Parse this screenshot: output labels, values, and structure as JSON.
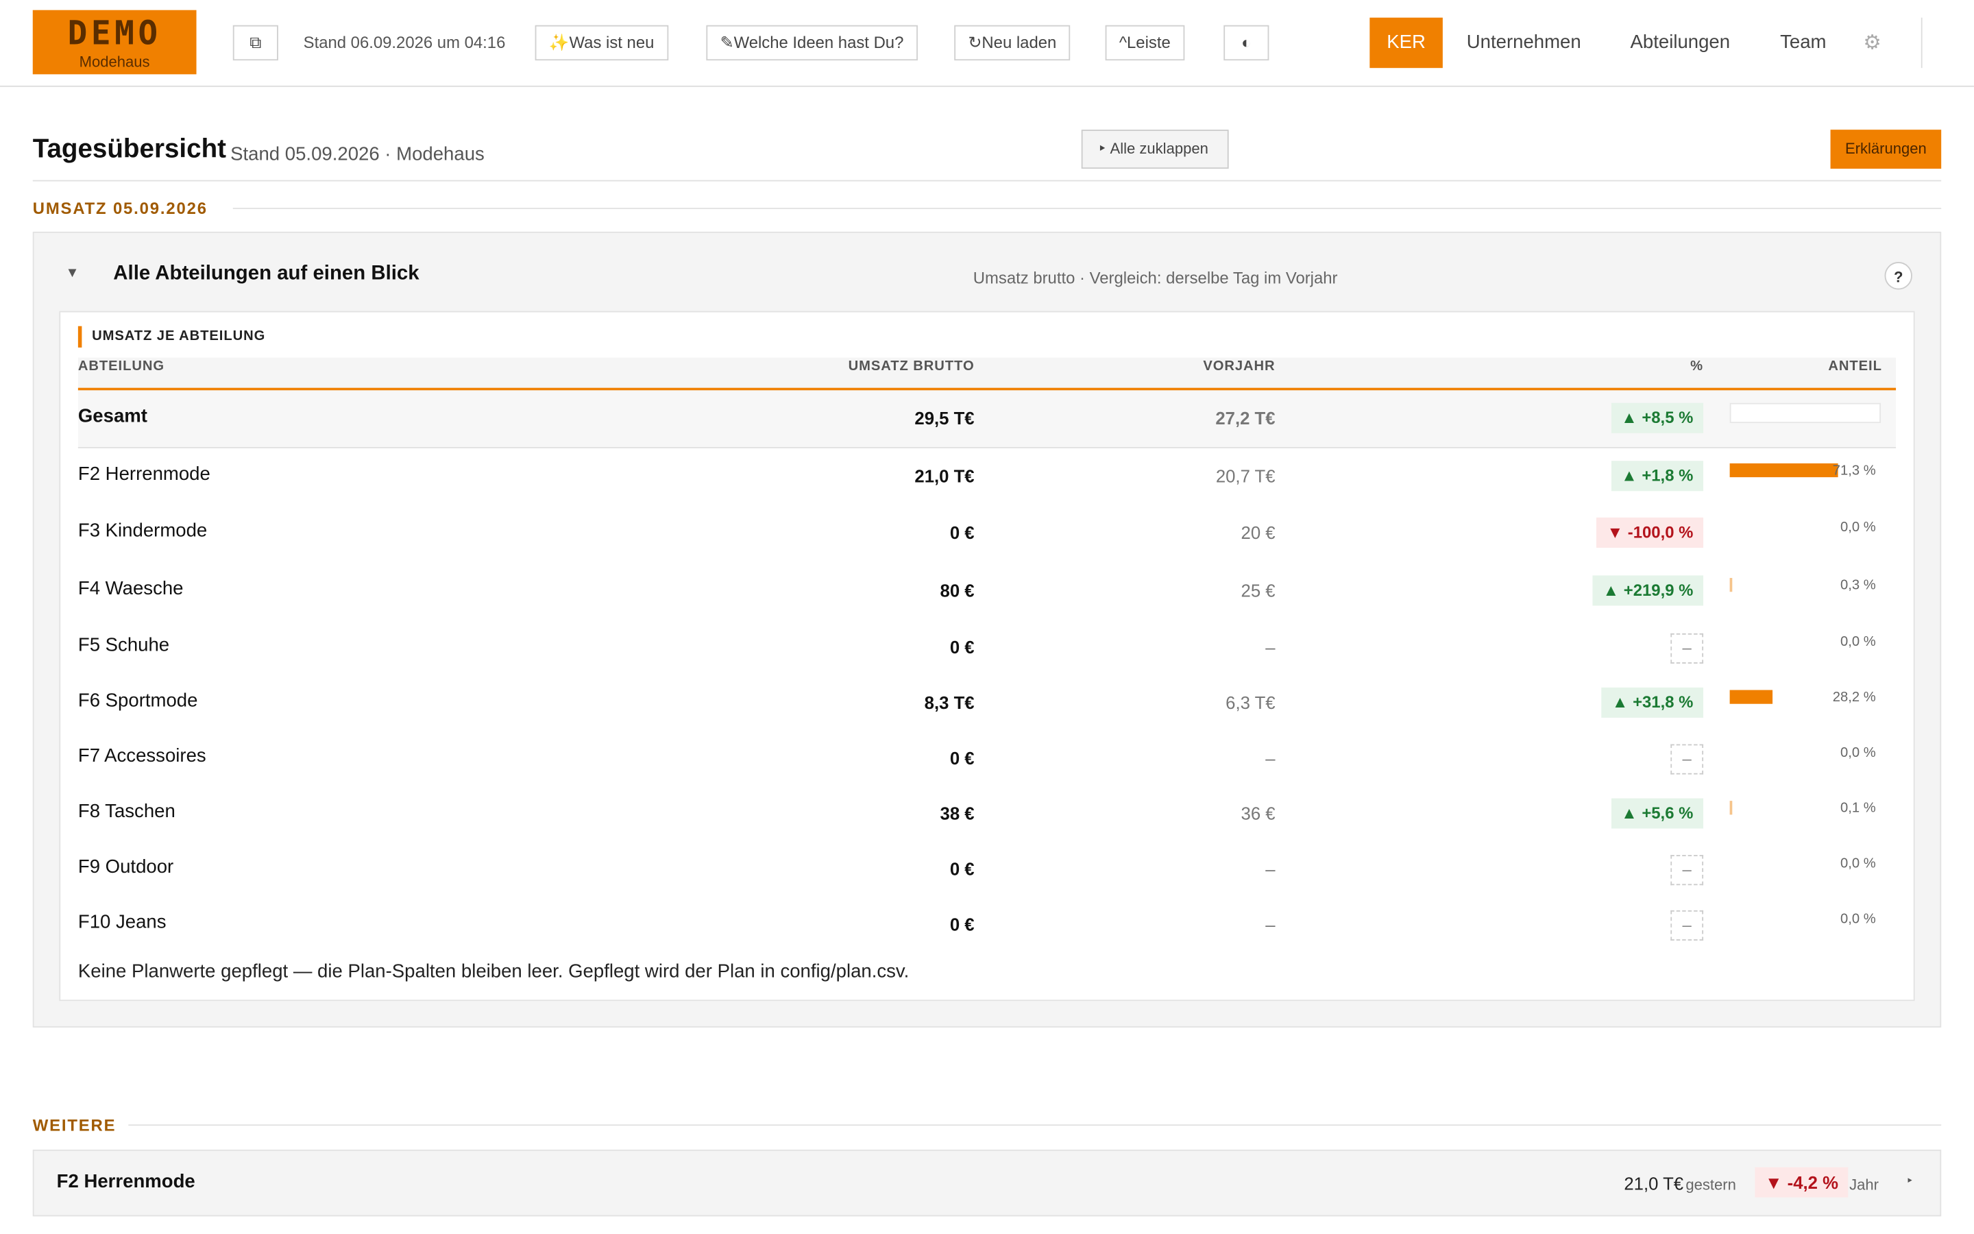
{
  "header": {
    "logo_title": "DEMO",
    "logo_subtitle": "Modehaus",
    "copy_icon": "⧉",
    "stand": "Stand 06.09.2026 um 04:16",
    "news_label": "✨Was ist neu",
    "ideas_label": "✎Welche Ideen hast Du?",
    "reload_label": "↻Neu laden",
    "bar_label": "^Leiste",
    "contrast_icon": "◐",
    "nav": {
      "active": "KER",
      "items": [
        "Unternehmen",
        "Abteilungen",
        "Team"
      ]
    },
    "gear_icon": "⚙"
  },
  "page": {
    "title": "Tagesübersicht",
    "subtitle": "Stand 05.09.2026 · Modehaus",
    "collapse_label": "‣ Alle zuklappen",
    "explain_label": "Erklärungen"
  },
  "section_umsatz": {
    "label": "UMSATZ 05.09.2026"
  },
  "panel": {
    "caret": "▼",
    "title": "Alle Abteilungen auf einen Blick",
    "subtitle": "Umsatz brutto · Vergleich: derselbe Tag im Vorjahr",
    "help": "?"
  },
  "table": {
    "label": "UMSATZ JE ABTEILUNG",
    "columns": [
      "ABTEILUNG",
      "UMSATZ BRUTTO",
      "VORJAHR",
      "%",
      "ANTEIL"
    ],
    "rows": [
      {
        "name": "Gesamt",
        "umsatz": "29,5 T€",
        "vorjahr": "27,2 T€",
        "pct": "▲ +8,5 %",
        "dir": "up",
        "share": "",
        "share_value": 0
      },
      {
        "name": "F2 Herrenmode",
        "umsatz": "21,0 T€",
        "vorjahr": "20,7 T€",
        "pct": "▲ +1,8 %",
        "dir": "up",
        "share": "71,3 %",
        "share_value": 71.3
      },
      {
        "name": "F3 Kindermode",
        "umsatz": "0 €",
        "vorjahr": "20 €",
        "pct": "▼ -100,0 %",
        "dir": "down",
        "share": "0,0 %",
        "share_value": 0
      },
      {
        "name": "F4 Waesche",
        "umsatz": "80 €",
        "vorjahr": "25 €",
        "pct": "▲ +219,9 %",
        "dir": "up",
        "share": "0,3 %",
        "share_value": 0.3
      },
      {
        "name": "F5 Schuhe",
        "umsatz": "0 €",
        "vorjahr": "–",
        "pct": "–",
        "dir": "na",
        "share": "0,0 %",
        "share_value": 0
      },
      {
        "name": "F6 Sportmode",
        "umsatz": "8,3 T€",
        "vorjahr": "6,3 T€",
        "pct": "▲ +31,8 %",
        "dir": "up",
        "share": "28,2 %",
        "share_value": 28.2
      },
      {
        "name": "F7 Accessoires",
        "umsatz": "0 €",
        "vorjahr": "–",
        "pct": "–",
        "dir": "na",
        "share": "0,0 %",
        "share_value": 0
      },
      {
        "name": "F8 Taschen",
        "umsatz": "38 €",
        "vorjahr": "36 €",
        "pct": "▲ +5,6 %",
        "dir": "up",
        "share": "0,1 %",
        "share_value": 0.1
      },
      {
        "name": "F9 Outdoor",
        "umsatz": "0 €",
        "vorjahr": "–",
        "pct": "–",
        "dir": "na",
        "share": "0,0 %",
        "share_value": 0
      },
      {
        "name": "F10 Jeans",
        "umsatz": "0 €",
        "vorjahr": "–",
        "pct": "–",
        "dir": "na",
        "share": "0,0 %",
        "share_value": 0
      }
    ],
    "note": "Keine Planwerte gepflegt — die Plan-Spalten bleiben leer. Gepflegt wird der Plan in config/plan.csv."
  },
  "section_weitere": {
    "label": "WEITERE"
  },
  "weitere": {
    "title": "F2 Herrenmode",
    "value": "21,0 T€",
    "value_note": "gestern",
    "pct": "▼ -4,2 %",
    "pct_note": "Jahr",
    "caret": "‣"
  },
  "colors": {
    "accent": "#f08000",
    "up": "#1b7a33",
    "down": "#b3121b"
  }
}
